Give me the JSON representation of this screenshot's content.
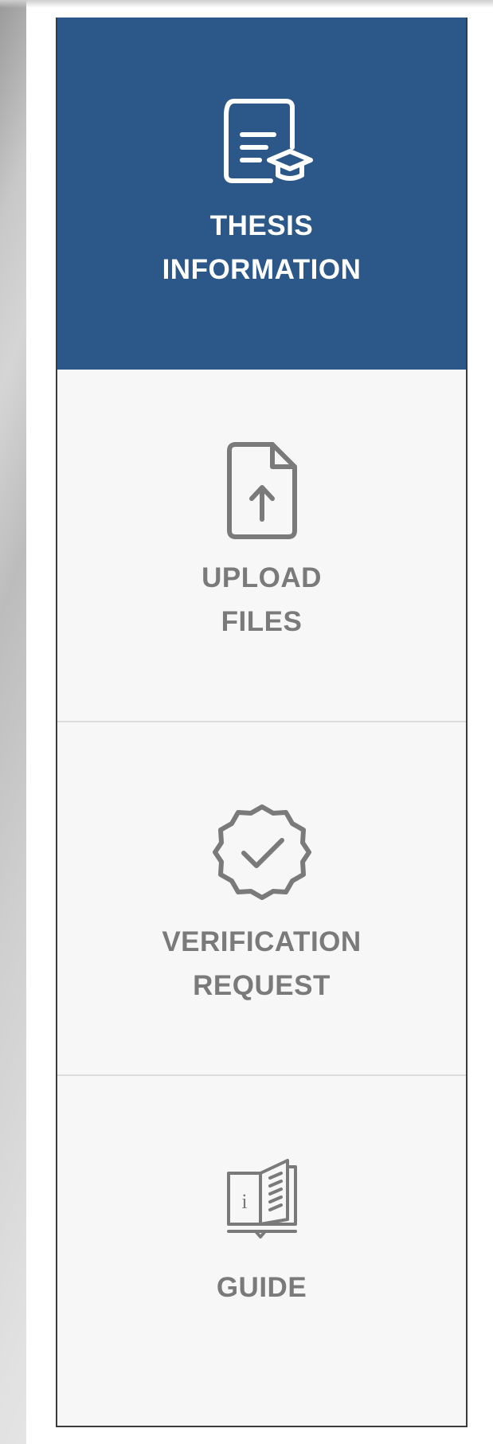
{
  "sidebar": {
    "items": [
      {
        "id": "thesis-information",
        "label": "THESIS\nINFORMATION",
        "icon": "thesis-document-icon",
        "active": true
      },
      {
        "id": "upload-files",
        "label": "UPLOAD\nFILES",
        "icon": "file-upload-icon",
        "active": false
      },
      {
        "id": "verification-request",
        "label": "VERIFICATION\nREQUEST",
        "icon": "verified-badge-icon",
        "active": false
      },
      {
        "id": "guide",
        "label": "GUIDE",
        "icon": "info-book-icon",
        "active": false
      }
    ]
  },
  "colors": {
    "active_background": "#2c5889",
    "active_text": "#ffffff",
    "inactive_text": "#7a7a7a",
    "sidebar_background": "#f7f7f7"
  }
}
